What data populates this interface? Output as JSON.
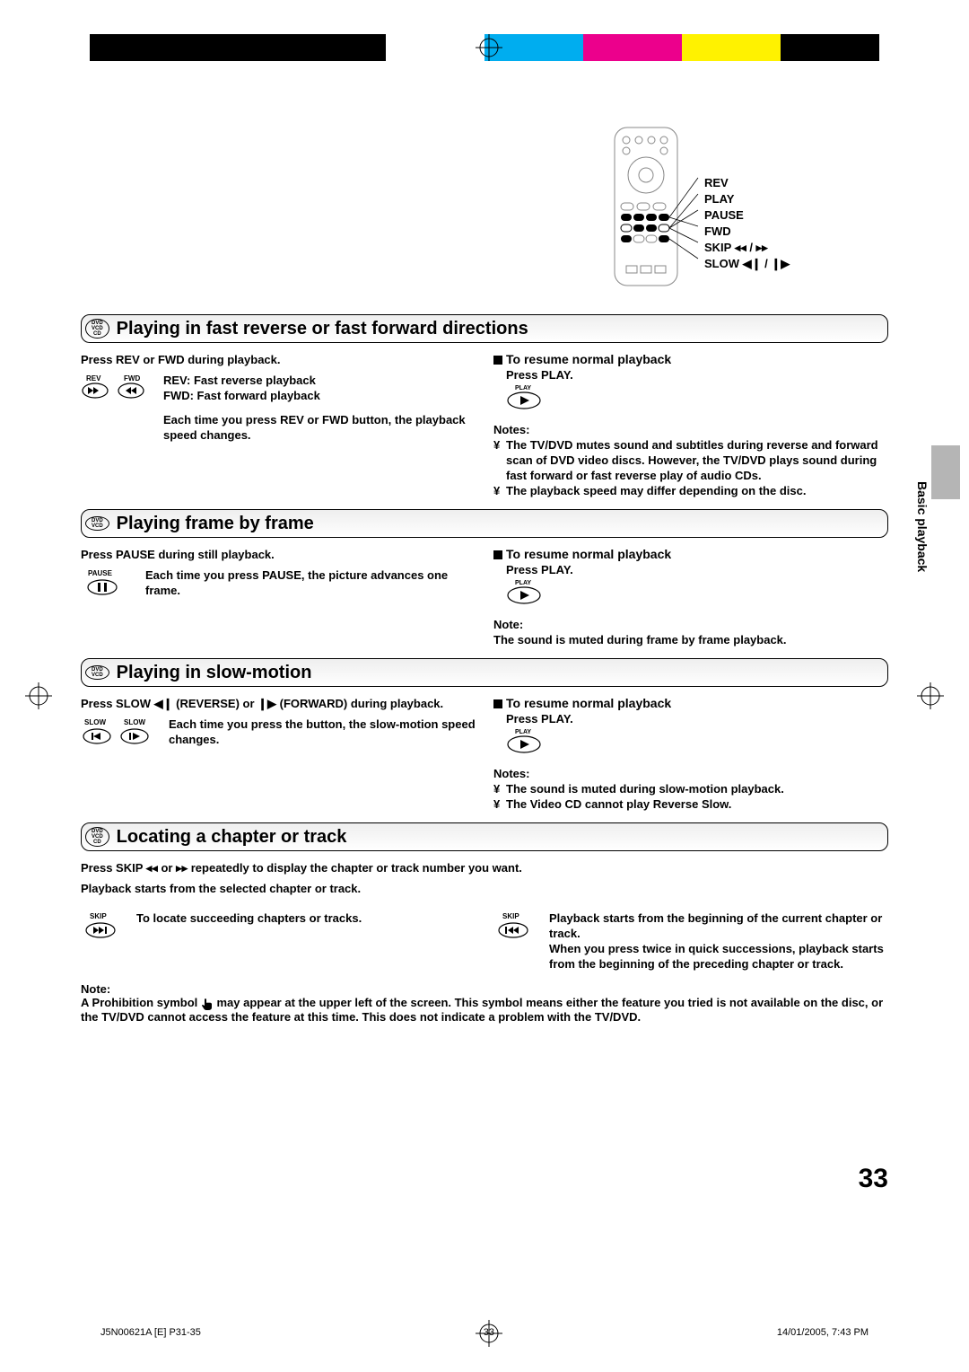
{
  "remote": {
    "rev": "REV",
    "play": "PLAY",
    "pause": "PAUSE",
    "fwd": "FWD",
    "skip": "SKIP",
    "slow": "SLOW"
  },
  "sec1": {
    "title": "Playing in fast reverse or fast forward directions",
    "discs": [
      "DVD",
      "VCD",
      "CD"
    ],
    "left": {
      "p1": "Press REV or FWD during playback.",
      "btn_rev": "REV",
      "btn_fwd": "FWD",
      "rev_desc": "REV:  Fast reverse playback",
      "fwd_desc": "FWD: Fast forward playback",
      "p2a": "Each time you press ",
      "p2b": "REV or FWD",
      "p2c": " button, the playback speed changes."
    },
    "right": {
      "resume_h": "To resume normal playback",
      "press": "Press ",
      "play": "PLAY",
      "dot": ".",
      "btn_play": "PLAY",
      "notes_h": "Notes:",
      "n1": "The TV/DVD mutes sound and subtitles during reverse and forward scan of DVD video discs. However, the TV/DVD plays sound during fast forward or fast reverse play of audio CDs.",
      "n2": "The playback speed may differ depending on the disc."
    }
  },
  "sec2": {
    "title": "Playing frame by frame",
    "discs": [
      "DVD",
      "VCD"
    ],
    "left": {
      "p1": "Press PAUSE during still playback.",
      "btn_pause": "PAUSE",
      "p2a": "Each time you press ",
      "p2b": "PAUSE",
      "p2c": ", the picture advances one frame."
    },
    "right": {
      "resume_h": "To resume normal playback",
      "press": "Press ",
      "play": "PLAY",
      "dot": ".",
      "btn_play": "PLAY",
      "note_h": "Note:",
      "n1": "The sound is muted during frame by frame playback."
    }
  },
  "sec3": {
    "title": "Playing in slow-motion",
    "discs": [
      "DVD",
      "VCD"
    ],
    "left": {
      "p1a": "Press SLOW ",
      "p1b": " (REVERSE) or ",
      "p1c": " (FORWARD) during playback.",
      "btn_slow_l": "SLOW",
      "btn_slow_r": "SLOW",
      "p2": "Each time you press the button, the slow-motion speed changes."
    },
    "right": {
      "resume_h": "To resume normal playback",
      "press": "Press ",
      "play": "PLAY",
      "dot": ".",
      "btn_play": "PLAY",
      "notes_h": "Notes:",
      "n1": "The sound is muted during slow-motion playback.",
      "n2": "The Video CD cannot play Reverse Slow."
    }
  },
  "sec4": {
    "title": "Locating a chapter or track",
    "discs": [
      "DVD",
      "VCD",
      "CD"
    ],
    "p1a": "Press SKIP ",
    "p1b": " or ",
    "p1c": " repeatedly to display the chapter or track number you want.",
    "p2": "Playback starts from the selected chapter or track.",
    "btn_skip_f": "SKIP",
    "btn_skip_b": "SKIP",
    "left_desc": "To locate succeeding chapters or tracks.",
    "right_desc_1": "Playback starts from the beginning of the current chapter or track.",
    "right_desc_2": "When you press twice in quick successions, playback starts from the beginning of the preceding chapter or track.",
    "note_h": "Note:",
    "note_body_a": "A  Prohibition ",
    "note_body_b": "symbol ",
    "note_body_c": " may appear at the upper left of the screen. This symbol means either the feature you tried is not available on the disc, or the TV/DVD cannot access the feature at this time. This does not indicate a problem with the TV/DVD."
  },
  "side_tab": "Basic playback",
  "page_number": "33",
  "footer": {
    "left": "J5N00621A [E] P31-35",
    "mid": "33",
    "right": "14/01/2005, 7:43 PM"
  },
  "bullet": "¥",
  "skip_prev_glyph": "◂◂",
  "skip_next_glyph": "▸▸",
  "slow_rev_glyph": "◀❙",
  "slow_fwd_glyph": "❙▶",
  "skip_sep": " / "
}
